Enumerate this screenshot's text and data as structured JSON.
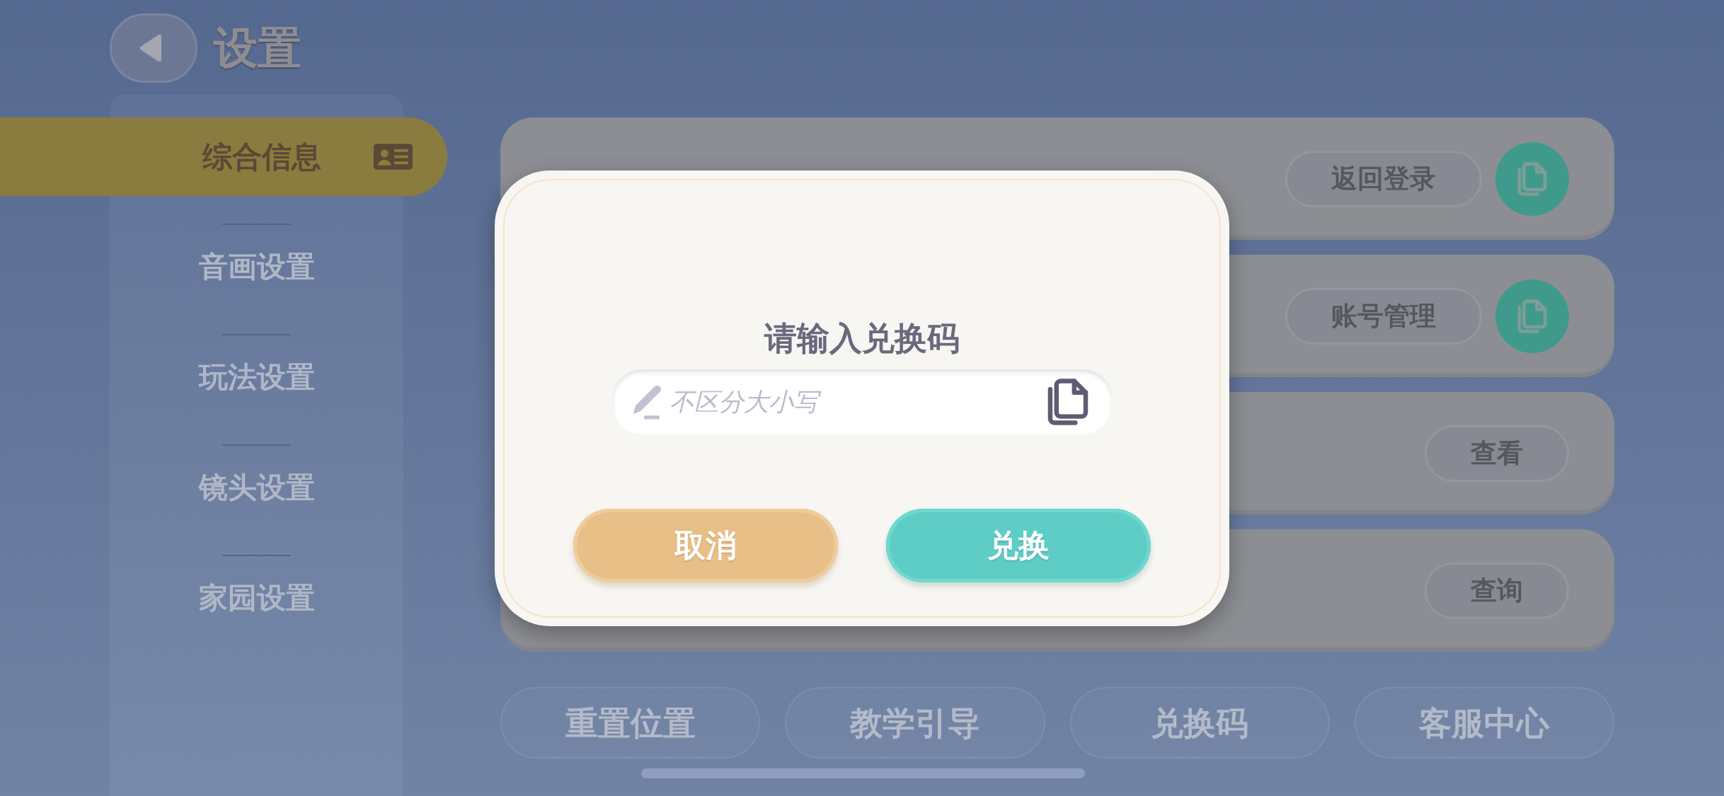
{
  "header": {
    "title": "设置"
  },
  "sidebar": {
    "items": [
      {
        "label": "综合信息",
        "selected": true
      },
      {
        "label": "音画设置",
        "selected": false
      },
      {
        "label": "玩法设置",
        "selected": false
      },
      {
        "label": "镜头设置",
        "selected": false
      },
      {
        "label": "家园设置",
        "selected": false
      }
    ]
  },
  "settings_rows": [
    {
      "action": "返回登录",
      "copy_button": true
    },
    {
      "action": "账号管理",
      "copy_button": true
    },
    {
      "action": "查看",
      "copy_button": false
    },
    {
      "action": "查询",
      "copy_button": false
    }
  ],
  "bottom_buttons": [
    "重置位置",
    "教学引导",
    "兑换码",
    "客服中心"
  ],
  "dialog": {
    "title": "请输入兑换码",
    "input": {
      "placeholder": "不区分大小写"
    },
    "buttons": [
      {
        "label": "取消",
        "kind": "cancel"
      },
      {
        "label": "兑换",
        "kind": "confirm"
      }
    ]
  }
}
